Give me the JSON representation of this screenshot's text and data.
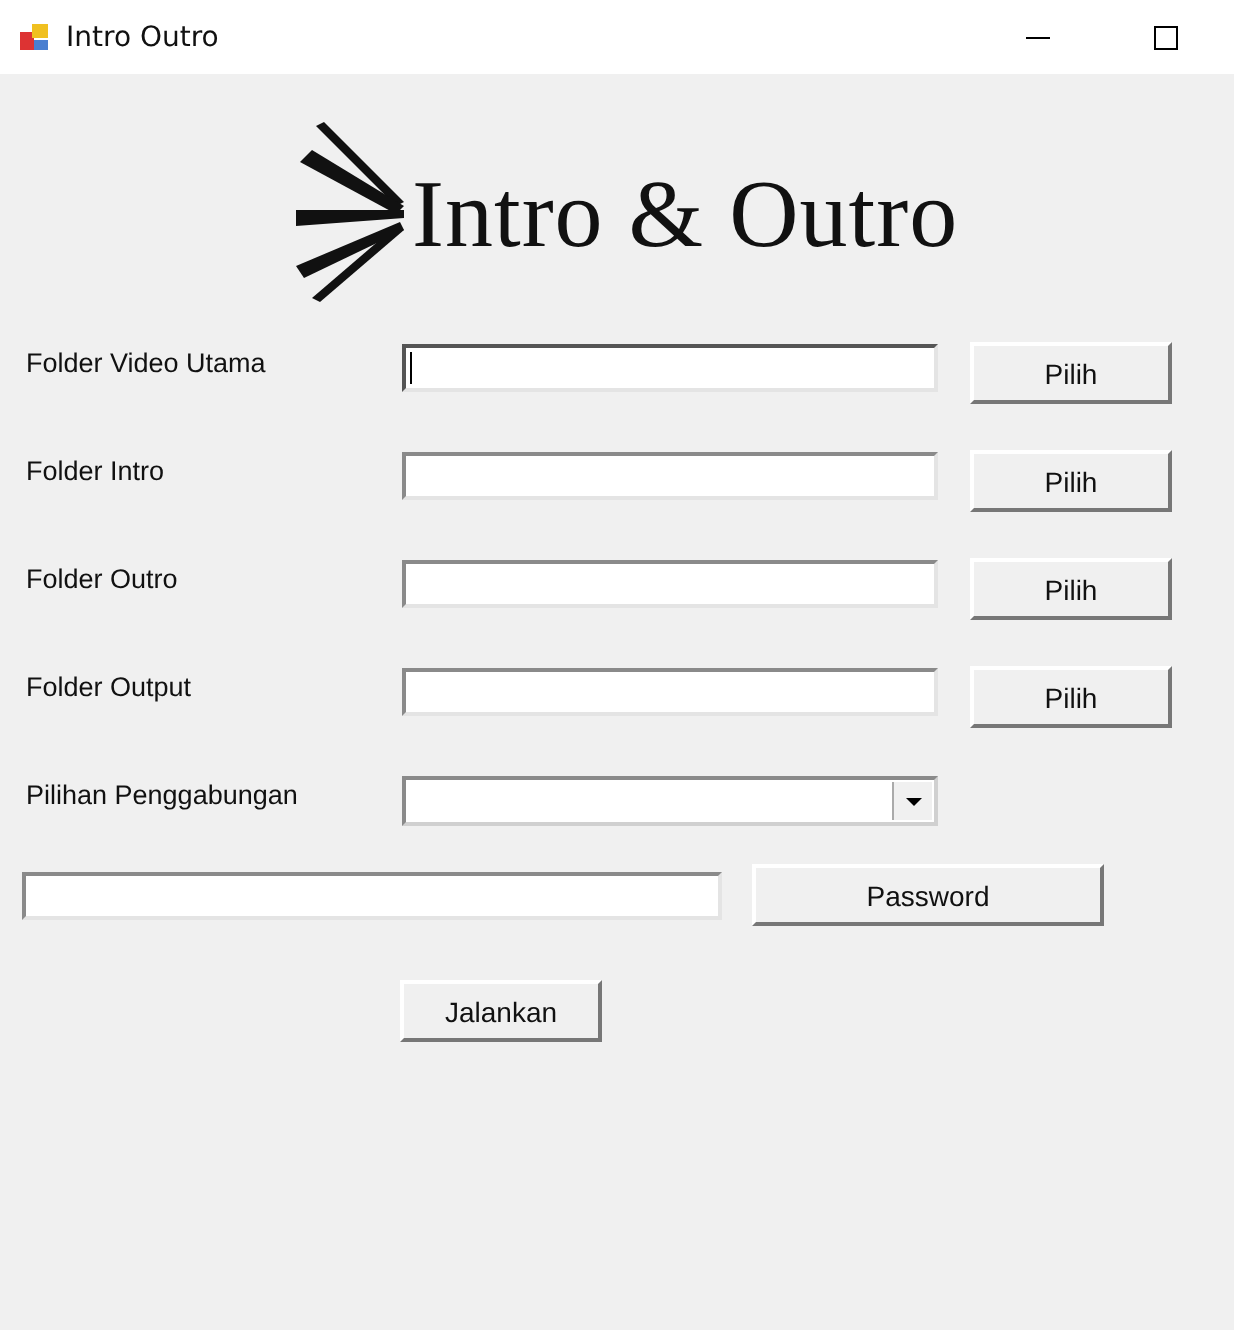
{
  "window": {
    "title": "Intro Outro"
  },
  "logo": {
    "text": "Intro & Outro"
  },
  "folder_rows": [
    {
      "label": "Folder Video Utama",
      "focused": true,
      "button": "Pilih"
    },
    {
      "label": "Folder Intro",
      "focused": false,
      "button": "Pilih"
    },
    {
      "label": "Folder Outro",
      "focused": false,
      "button": "Pilih"
    },
    {
      "label": "Folder Output",
      "focused": false,
      "button": "Pilih"
    }
  ],
  "merge_option": {
    "label": "Pilihan Penggabungan"
  },
  "password": {
    "button": "Password"
  },
  "run_button": "Jalankan"
}
